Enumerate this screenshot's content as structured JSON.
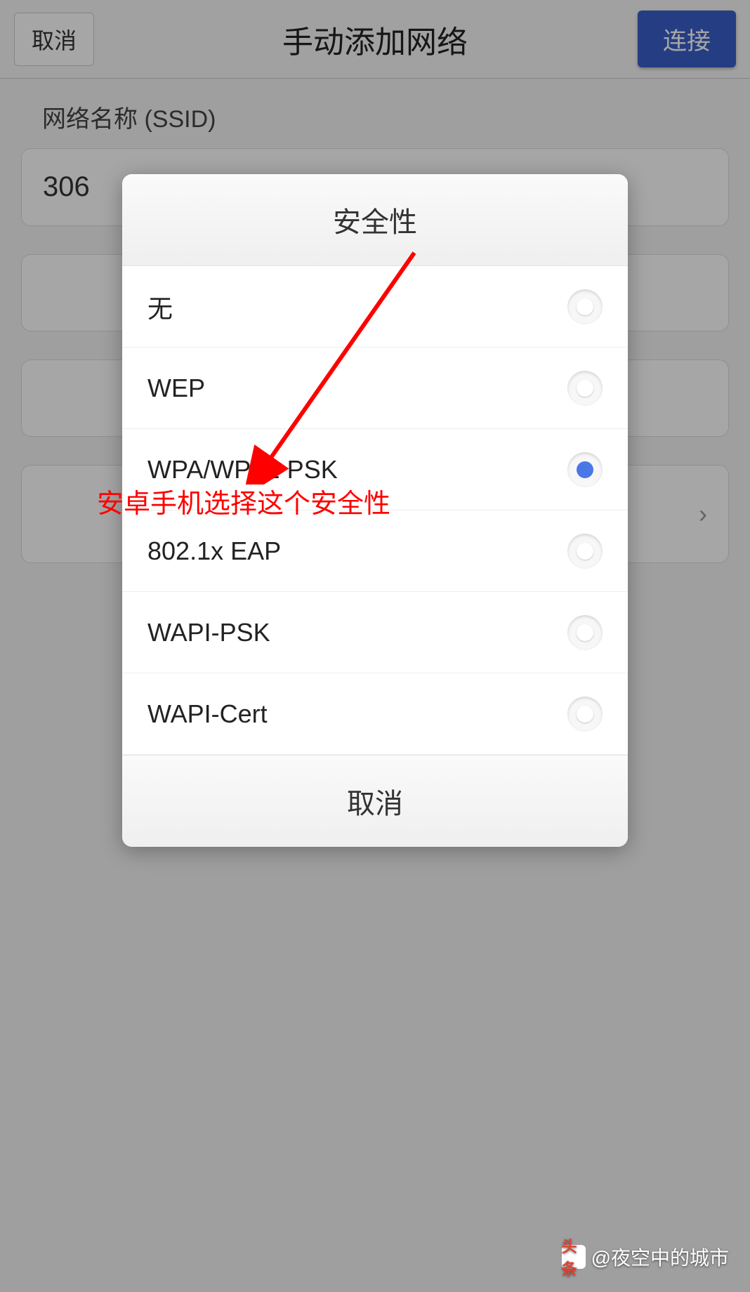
{
  "header": {
    "cancel": "取消",
    "title": "手动添加网络",
    "connect": "连接"
  },
  "background": {
    "ssid_label": "网络名称 (SSID)",
    "ssid_value": "306"
  },
  "modal": {
    "title": "安全性",
    "options": [
      {
        "label": "无",
        "selected": false
      },
      {
        "label": "WEP",
        "selected": false
      },
      {
        "label": "WPA/WPA2 PSK",
        "selected": true
      },
      {
        "label": "802.1x EAP",
        "selected": false
      },
      {
        "label": "WAPI-PSK",
        "selected": false
      },
      {
        "label": "WAPI-Cert",
        "selected": false
      }
    ],
    "cancel": "取消"
  },
  "annotation": {
    "text": "安卓手机选择这个安全性"
  },
  "watermark": {
    "logo": "头条",
    "text": "@夜空中的城市"
  }
}
